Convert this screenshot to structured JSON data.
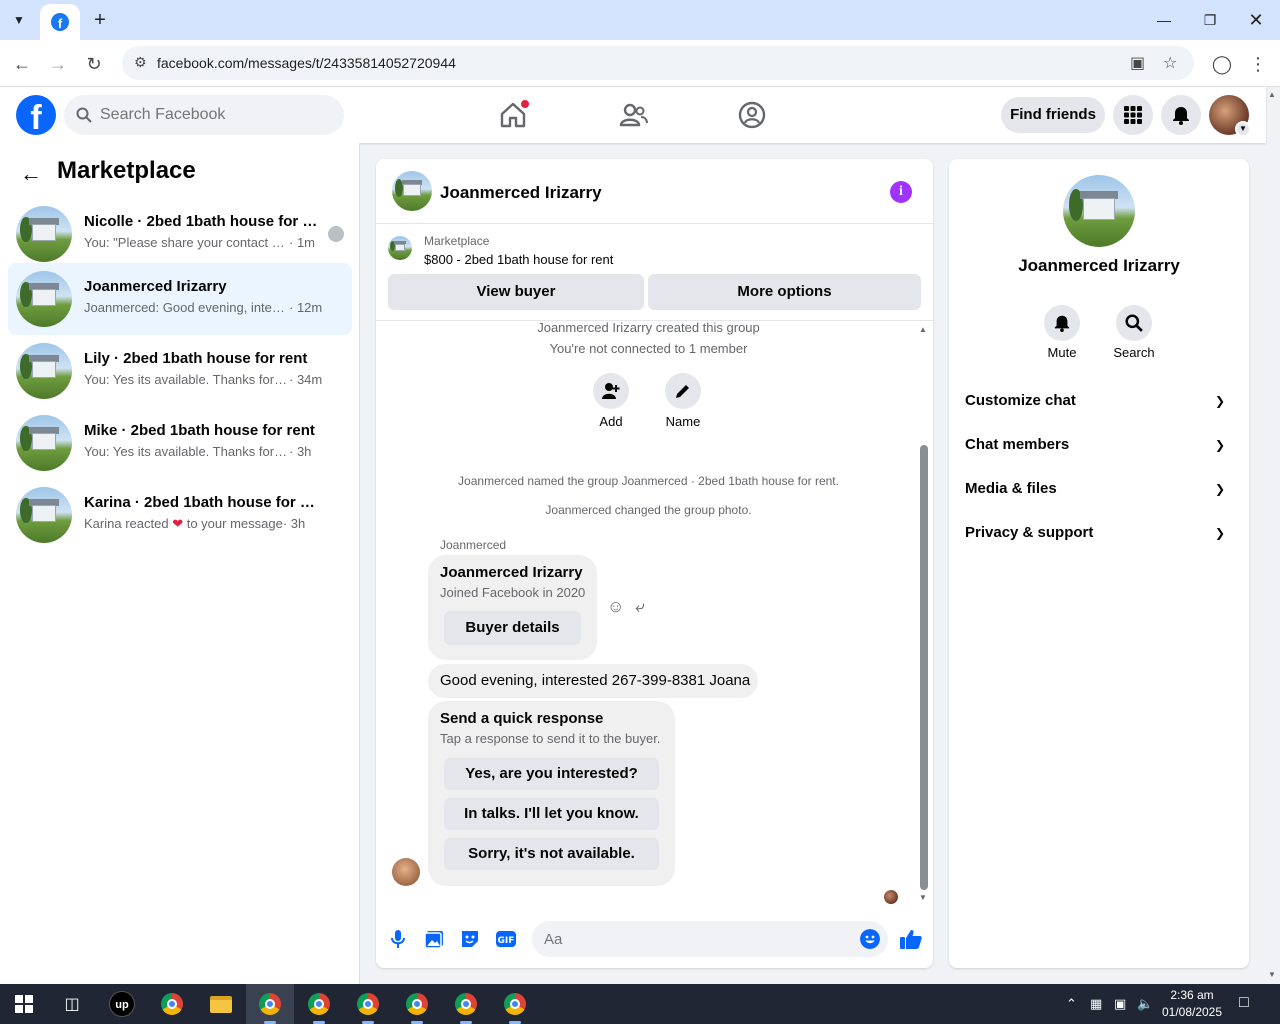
{
  "browser": {
    "url": "facebook.com/messages/t/24335814052720944"
  },
  "header": {
    "search_placeholder": "Search Facebook",
    "find_friends": "Find friends"
  },
  "sidebar": {
    "title": "Marketplace",
    "conversations": [
      {
        "name": "Nicolle · 2bed 1bath house for r...",
        "snippet": "You: \"Please share your contact nu...",
        "time": "· 1m"
      },
      {
        "name": "Joanmerced Irizarry",
        "snippet": "Joanmerced: Good evening, interest...",
        "time": "· 12m"
      },
      {
        "name": "Lily · 2bed 1bath house for rent",
        "snippet": "You: Yes its available. Thanks for me...",
        "time": "· 34m"
      },
      {
        "name": "Mike · 2bed 1bath house for rent",
        "snippet": "You: Yes its available. Thanks for mess...",
        "time": "· 3h"
      },
      {
        "name": "Karina · 2bed 1bath house for rent",
        "snippet": "Karina reacted",
        "snippet_after": "to your message",
        "time": "· 3h"
      }
    ]
  },
  "chat": {
    "title": "Joanmerced Irizarry",
    "marketplace_label": "Marketplace",
    "listing": "$800 - 2bed 1bath house for rent",
    "view_buyer": "View buyer",
    "more_options": "More options",
    "created": "Joanmerced Irizarry created this group",
    "not_connected": "You're not connected to 1 member",
    "add_label": "Add",
    "name_label": "Name",
    "named_group": "Joanmerced named the group Joanmerced · 2bed 1bath house for rent.",
    "changed_photo": "Joanmerced changed the group photo.",
    "sender": "Joanmerced",
    "card_name": "Joanmerced Irizarry",
    "card_sub": "Joined Facebook in 2020",
    "buyer_details": "Buyer details",
    "message": "Good evening, interested 267-399-8381 Joana",
    "quick_title": "Send a quick response",
    "quick_sub": "Tap a response to send it to the buyer.",
    "quick_responses": [
      "Yes, are you interested?",
      "In talks. I'll let you know.",
      "Sorry, it's not available."
    ],
    "input_placeholder": "Aa"
  },
  "details": {
    "name": "Joanmerced Irizarry",
    "mute": "Mute",
    "search": "Search",
    "sections": [
      "Customize chat",
      "Chat members",
      "Media & files",
      "Privacy & support"
    ]
  },
  "taskbar": {
    "time": "2:36 am",
    "date": "01/08/2025"
  },
  "colors": {
    "fb_blue": "#0866ff",
    "active_conv": "#ebf5ff",
    "info_purple": "#a033ff",
    "heart_red": "#e41e3f"
  }
}
